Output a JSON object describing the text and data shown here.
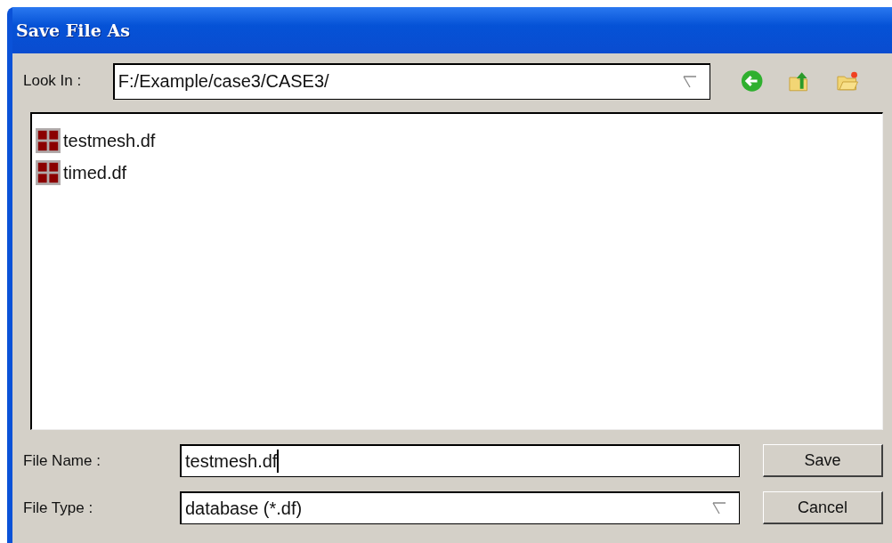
{
  "window": {
    "title": "Save File As"
  },
  "look_in": {
    "label": "Look In :",
    "value": "F:/Example/case3/CASE3/"
  },
  "files": [
    {
      "name": "testmesh.df",
      "selected": false
    },
    {
      "name": "timed.df",
      "selected": false
    }
  ],
  "file_name": {
    "label": "File Name :",
    "value": "testmesh.df"
  },
  "file_type": {
    "label": "File Type :",
    "value": "database (*.df)"
  },
  "buttons": [
    {
      "label": "Save"
    },
    {
      "label": "Cancel"
    }
  ]
}
